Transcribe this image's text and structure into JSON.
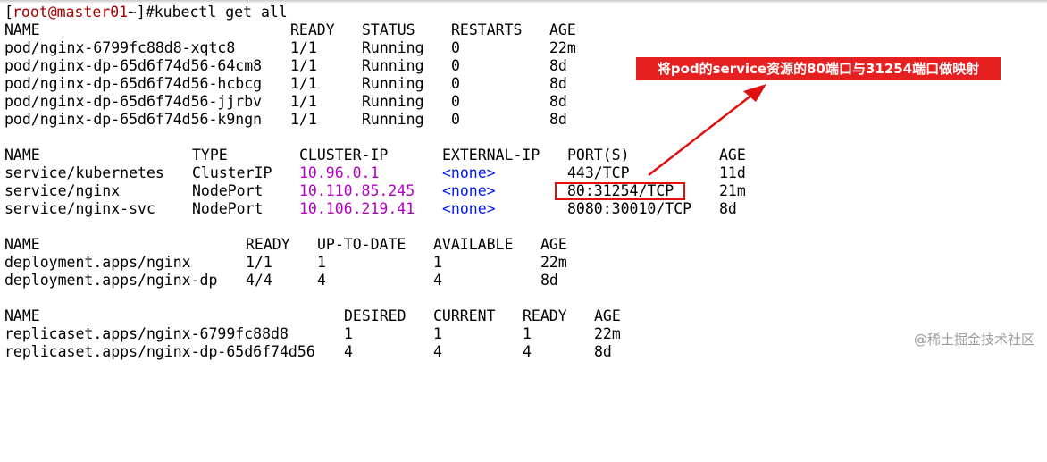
{
  "prompt": {
    "open": "[",
    "user_host": "root@master01",
    "rest": " ~]#kubectl get all"
  },
  "pods": {
    "headers": [
      "NAME",
      "READY",
      "STATUS",
      "RESTARTS",
      "AGE"
    ],
    "rows": [
      [
        "pod/nginx-6799fc88d8-xqtc8",
        "1/1",
        "Running",
        "0",
        "22m"
      ],
      [
        "pod/nginx-dp-65d6f74d56-64cm8",
        "1/1",
        "Running",
        "0",
        "8d"
      ],
      [
        "pod/nginx-dp-65d6f74d56-hcbcg",
        "1/1",
        "Running",
        "0",
        "8d"
      ],
      [
        "pod/nginx-dp-65d6f74d56-jjrbv",
        "1/1",
        "Running",
        "0",
        "8d"
      ],
      [
        "pod/nginx-dp-65d6f74d56-k9ngn",
        "1/1",
        "Running",
        "0",
        "8d"
      ]
    ]
  },
  "services": {
    "headers": [
      "NAME",
      "TYPE",
      "CLUSTER-IP",
      "EXTERNAL-IP",
      "PORT(S)",
      "AGE"
    ],
    "rows": [
      [
        "service/kubernetes",
        "ClusterIP",
        "10.96.0.1",
        "<none>",
        "443/TCP",
        "11d"
      ],
      [
        "service/nginx",
        "NodePort",
        "10.110.85.245",
        "<none>",
        "80:31254/TCP",
        "21m"
      ],
      [
        "service/nginx-svc",
        "NodePort",
        "10.106.219.41",
        "<none>",
        "8080:30010/TCP",
        "8d"
      ]
    ]
  },
  "deployments": {
    "headers": [
      "NAME",
      "READY",
      "UP-TO-DATE",
      "AVAILABLE",
      "AGE"
    ],
    "rows": [
      [
        "deployment.apps/nginx",
        "1/1",
        "1",
        "1",
        "22m"
      ],
      [
        "deployment.apps/nginx-dp",
        "4/4",
        "4",
        "4",
        "8d"
      ]
    ]
  },
  "replicasets": {
    "headers": [
      "NAME",
      "DESIRED",
      "CURRENT",
      "READY",
      "AGE"
    ],
    "rows": [
      [
        "replicaset.apps/nginx-6799fc88d8",
        "1",
        "1",
        "1",
        "22m"
      ],
      [
        "replicaset.apps/nginx-dp-65d6f74d56",
        "4",
        "4",
        "4",
        "8d"
      ]
    ]
  },
  "annotation": {
    "text": "将pod的service资源的80端口与31254端口做映射"
  },
  "watermark": "@稀土掘金技术社区",
  "colors": {
    "cluster_ip": "#b000c0",
    "none": "#0018e8",
    "annotation": "#e62020"
  }
}
